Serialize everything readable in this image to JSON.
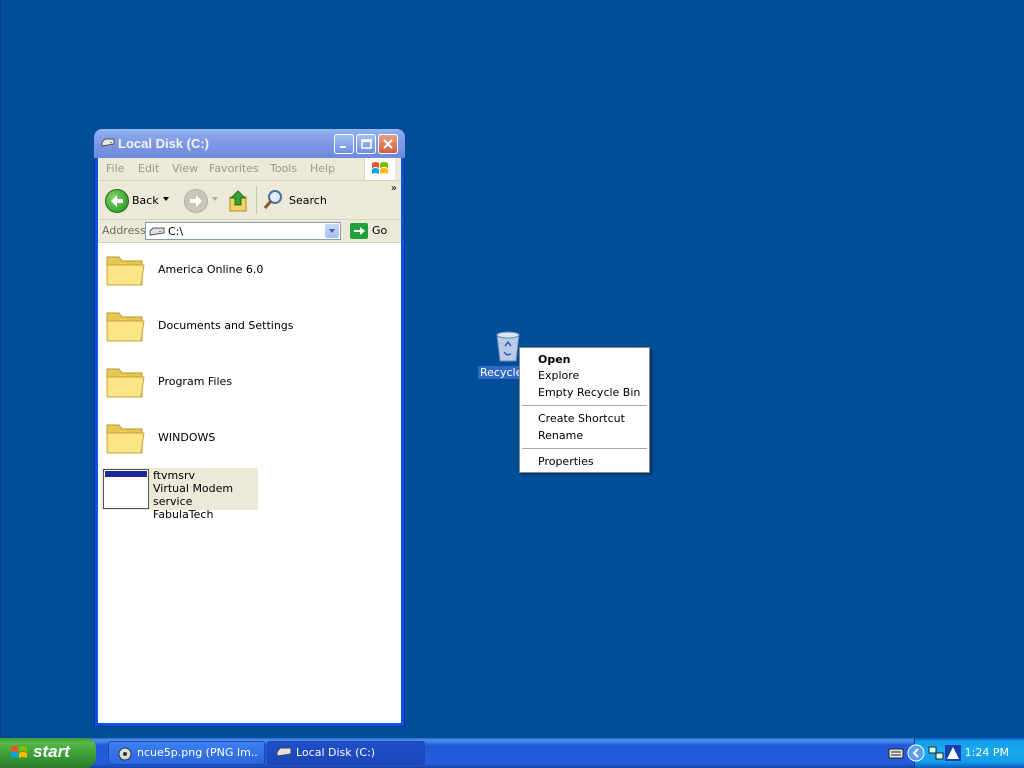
{
  "window": {
    "title": "Local Disk (C:)",
    "menu": [
      "File",
      "Edit",
      "View",
      "Favorites",
      "Tools",
      "Help"
    ],
    "toolbar": {
      "back": "Back",
      "search": "Search",
      "more": "»"
    },
    "address": {
      "label": "Address",
      "value": "C:\\",
      "go": "Go"
    },
    "items": [
      {
        "name": "America Online 6.0",
        "type": "folder"
      },
      {
        "name": "Documents and Settings",
        "type": "folder"
      },
      {
        "name": "Program Files",
        "type": "folder"
      },
      {
        "name": "WINDOWS",
        "type": "folder"
      }
    ],
    "exe": {
      "name": "ftvmsrv",
      "description": "Virtual Modem service",
      "company": "FabulaTech"
    }
  },
  "desktop": {
    "recycle_label": "Recycle"
  },
  "context_menu": {
    "items": [
      "Open",
      "Explore",
      "Empty Recycle Bin",
      "Create Shortcut",
      "Rename",
      "Properties"
    ]
  },
  "taskbar": {
    "start": "start",
    "tasks": [
      "ncue5p.png (PNG Im...",
      "Local Disk (C:)"
    ],
    "clock": "1:24 PM"
  },
  "colors": {
    "desktop": "#004E98",
    "selection": "#316AC5",
    "taskbar": "#245EDB",
    "start": "#3A9A35"
  }
}
